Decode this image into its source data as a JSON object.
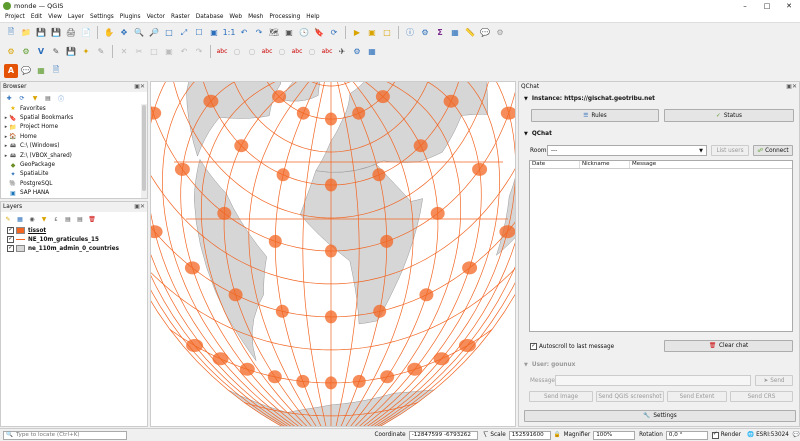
{
  "window": {
    "title": "monde — QGIS"
  },
  "menu": [
    "Project",
    "Edit",
    "View",
    "Layer",
    "Settings",
    "Plugins",
    "Vector",
    "Raster",
    "Database",
    "Web",
    "Mesh",
    "Processing",
    "Help"
  ],
  "browser": {
    "title": "Browser",
    "items": [
      {
        "label": "Favorites",
        "icon": "star-icon",
        "expand": false
      },
      {
        "label": "Spatial Bookmarks",
        "icon": "bookmark-icon",
        "expand": true
      },
      {
        "label": "Project Home",
        "icon": "folder-icon",
        "expand": true
      },
      {
        "label": "Home",
        "icon": "home-folder-icon",
        "expand": true
      },
      {
        "label": "C:\\ (Windows)",
        "icon": "drive-icon",
        "expand": true
      },
      {
        "label": "Z:\\ (VBOX_shared)",
        "icon": "drive-icon",
        "expand": true
      },
      {
        "label": "GeoPackage",
        "icon": "geopackage-icon",
        "expand": false
      },
      {
        "label": "SpatiaLite",
        "icon": "spatialite-icon",
        "expand": false
      },
      {
        "label": "PostgreSQL",
        "icon": "postgresql-icon",
        "expand": false
      },
      {
        "label": "SAP HANA",
        "icon": "sap-hana-icon",
        "expand": false
      }
    ]
  },
  "layers": {
    "title": "Layers",
    "items": [
      {
        "label": "tissot",
        "checked": true,
        "swatch": "#f26522",
        "bold": true,
        "underline": true
      },
      {
        "label": "NE_10m_graticules_15",
        "checked": true,
        "swatch": "#f26522",
        "bold": true,
        "line": true
      },
      {
        "label": "ne_110m_admin_0_countries",
        "checked": true,
        "swatch": "#d8d8d8",
        "bold": true
      }
    ]
  },
  "qchat": {
    "title": "QChat",
    "instance_label": "Instance: https://gischat.geotribu.net",
    "rules_button": "Rules",
    "status_button": "Status",
    "section_label": "QChat",
    "room_label": "Room:",
    "room_value": "---",
    "list_users_button": "List users",
    "connect_button": "Connect",
    "table_headers": [
      "Date",
      "Nickname",
      "Message"
    ],
    "autoscroll_label": "Autoscroll to last message",
    "autoscroll_checked": true,
    "clear_chat_button": "Clear chat",
    "user_section_label": "User: gounux",
    "message_label": "Message:",
    "send_button": "Send",
    "send_image_button": "Send Image",
    "send_screenshot_button": "Send QGIS screenshot",
    "send_extent_button": "Send Extent",
    "send_crs_button": "Send CRS",
    "settings_button": "Settings"
  },
  "status": {
    "locate_placeholder": "Type to locate (Ctrl+K)",
    "coordinate_label": "Coordinate",
    "coordinate_value": "-12847599  -6793262",
    "scale_label": "Scale",
    "scale_value": "152591600",
    "magnifier_label": "Magnifier",
    "magnifier_value": "100%",
    "rotation_label": "Rotation",
    "rotation_value": "0,0 °",
    "render_label": "Render",
    "crs_label": "ESRI:53024"
  },
  "colors": {
    "graticule": "#f26522",
    "tissot": "#f26522",
    "land": "#d6d6d6",
    "accent": "#ffcc00"
  }
}
